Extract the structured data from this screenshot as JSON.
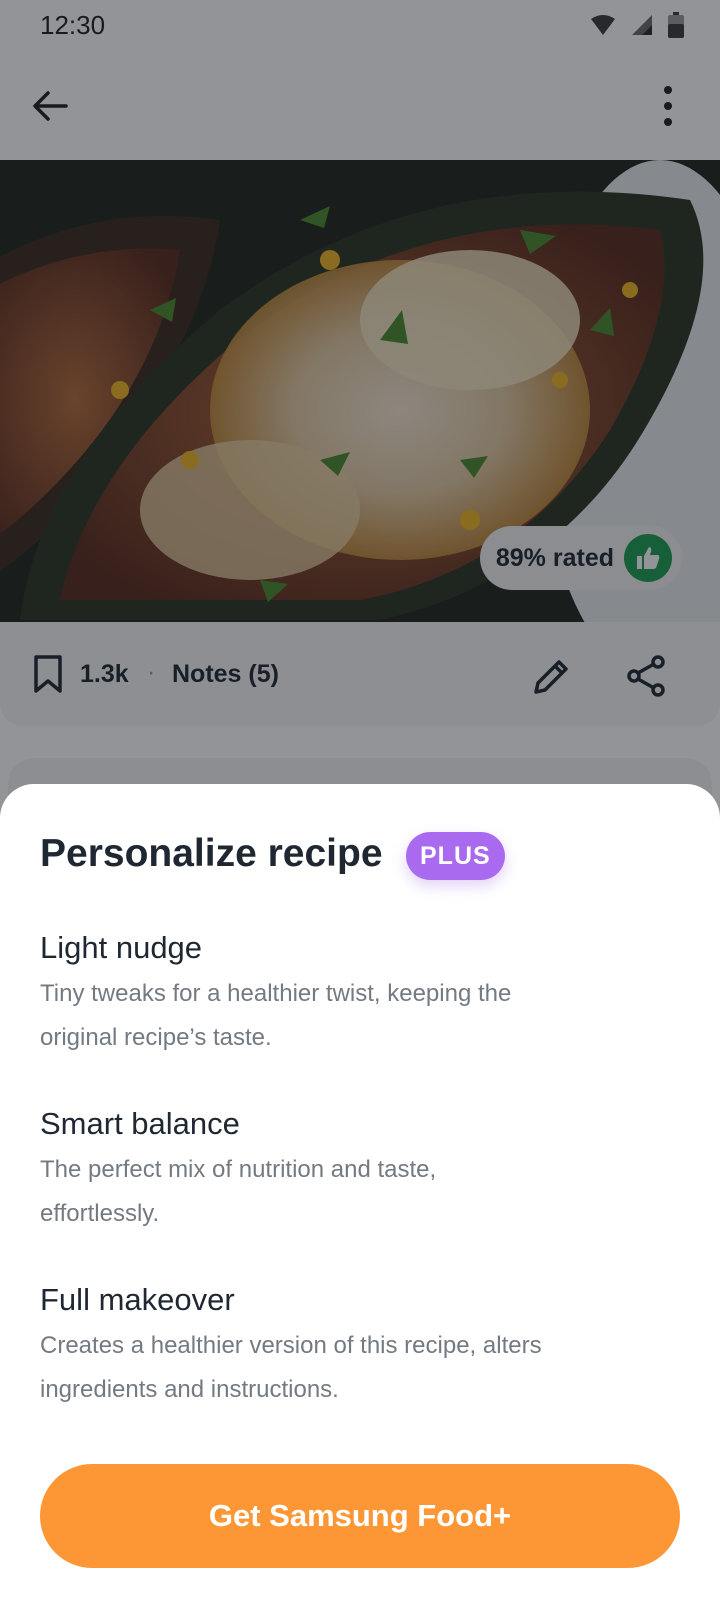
{
  "status_bar": {
    "time": "12:30"
  },
  "hero": {
    "rating_text": "89% rated"
  },
  "actions": {
    "save_count": "1.3k",
    "separator": "·",
    "notes": "Notes (5)"
  },
  "sheet": {
    "title": "Personalize recipe",
    "badge": "PLUS",
    "options": [
      {
        "title": "Light nudge",
        "description": "Tiny tweaks for a healthier twist, keeping the original recipe’s taste."
      },
      {
        "title": "Smart balance",
        "description": "The perfect mix of nutrition and taste, effortlessly."
      },
      {
        "title": "Full makeover",
        "description": "Creates a healthier version of this recipe, alters ingredients and instructions."
      }
    ],
    "cta_label": "Get Samsung Food+"
  },
  "colors": {
    "cta": "#fd9735",
    "plus_badge": "#a96af0",
    "rating_thumb": "#1a9e52",
    "title_text": "#1f2733",
    "body_text": "#747a82"
  },
  "icons": [
    "wifi-icon",
    "signal-icon",
    "battery-icon",
    "back-arrow-icon",
    "more-vert-icon",
    "bookmark-icon",
    "pencil-icon",
    "share-icon",
    "thumbs-up-icon"
  ]
}
